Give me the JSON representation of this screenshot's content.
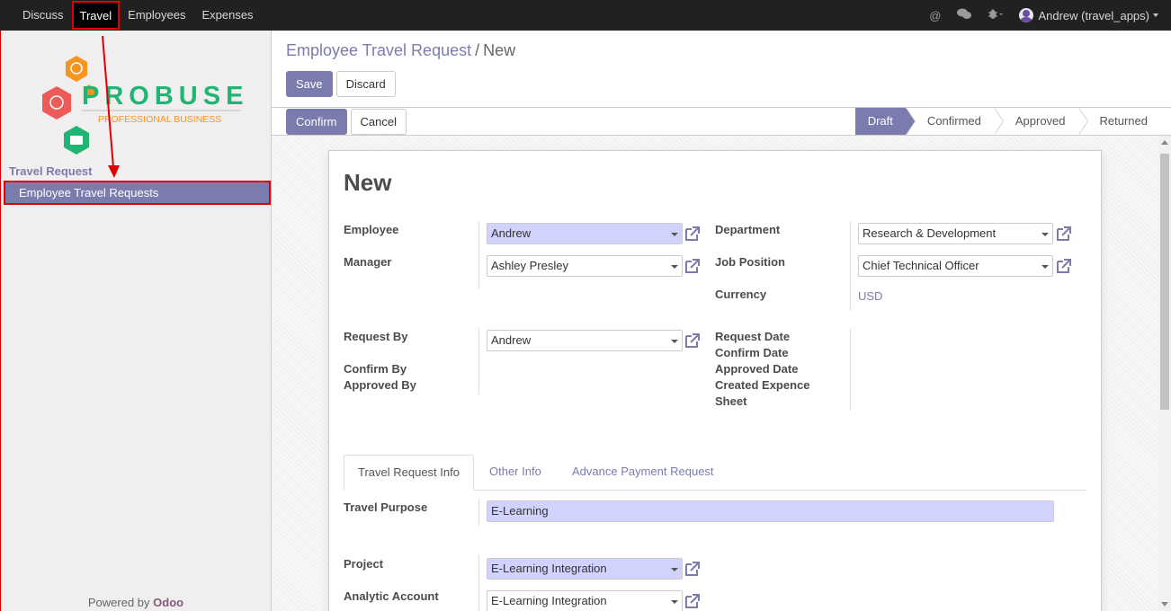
{
  "topbar": {
    "menu": [
      {
        "label": "Discuss"
      },
      {
        "label": "Travel"
      },
      {
        "label": "Employees"
      },
      {
        "label": "Expenses"
      }
    ],
    "user_label": "Andrew (travel_apps)"
  },
  "sidebar": {
    "logo_text": "PROBUSE",
    "logo_subtext": "PROFESSIONAL BUSINESS",
    "section": "Travel Request",
    "item": "Employee Travel Requests",
    "powered_prefix": "Powered by",
    "powered_brand": "Odoo"
  },
  "breadcrumb": {
    "parent": "Employee Travel Request",
    "separator": "/",
    "current": "New"
  },
  "buttons": {
    "save": "Save",
    "discard": "Discard",
    "confirm": "Confirm",
    "cancel": "Cancel"
  },
  "stages": [
    "Draft",
    "Confirmed",
    "Approved",
    "Returned"
  ],
  "form": {
    "title": "New",
    "employee_label": "Employee",
    "employee_value": "Andrew",
    "manager_label": "Manager",
    "manager_value": "Ashley Presley",
    "department_label": "Department",
    "department_value": "Research & Development",
    "job_label": "Job Position",
    "job_value": "Chief Technical Officer",
    "currency_label": "Currency",
    "currency_value": "USD",
    "request_by_label": "Request By",
    "request_by_value": "Andrew",
    "confirm_by_label": "Confirm By",
    "approved_by_label": "Approved By",
    "request_date_label": "Request Date",
    "confirm_date_label": "Confirm Date",
    "approved_date_label": "Approved Date",
    "created_sheet_label_1": "Created Expence",
    "created_sheet_label_2": "Sheet"
  },
  "tabs": [
    "Travel Request Info",
    "Other Info",
    "Advance Payment Request"
  ],
  "tab_info": {
    "purpose_label": "Travel Purpose",
    "purpose_value": "E-Learning",
    "project_label": "Project",
    "project_value": "E-Learning Integration",
    "analytic_label": "Analytic Account",
    "analytic_value": "E-Learning Integration"
  },
  "colors": {
    "accent": "#7c7bad",
    "required_field": "#d2d2ff",
    "annotation": "#e10000"
  }
}
